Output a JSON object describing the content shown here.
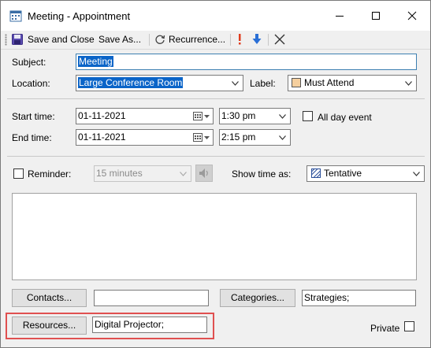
{
  "window": {
    "title": "Meeting - Appointment"
  },
  "toolbar": {
    "save_close_label": "Save and Close",
    "save_as_label": "Save As...",
    "recurrence_label": "Recurrence...",
    "priority_high_icon": "exclamation",
    "priority_low_icon": "down-arrow",
    "delete_icon": "x-mark"
  },
  "form": {
    "subject_label": "Subject:",
    "subject_value": "Meeting",
    "location_label": "Location:",
    "location_value": "Large Conference Room",
    "label_label": "Label:",
    "label_value": "Must Attend",
    "label_color": "#f5cf9e",
    "start_time_label": "Start time:",
    "start_date": "01-11-2021",
    "start_time": "1:30 pm",
    "end_time_label": "End time:",
    "end_date": "01-11-2021",
    "end_time": "2:15 pm",
    "all_day_label": "All day event",
    "all_day_checked": false,
    "reminder_label": "Reminder:",
    "reminder_checked": false,
    "reminder_value": "15 minutes",
    "show_time_as_label": "Show time as:",
    "show_time_as_value": "Tentative",
    "notes": "",
    "contacts_button": "Contacts...",
    "contacts_value": "",
    "categories_button": "Categories...",
    "categories_value": "Strategies;",
    "resources_button": "Resources...",
    "resources_value": "Digital Projector;",
    "private_label": "Private",
    "private_checked": false
  },
  "colors": {
    "highlight": "#e05050",
    "selection": "#0a64c8",
    "priority_high": "#e03c1e",
    "priority_low": "#2a6fd6"
  }
}
